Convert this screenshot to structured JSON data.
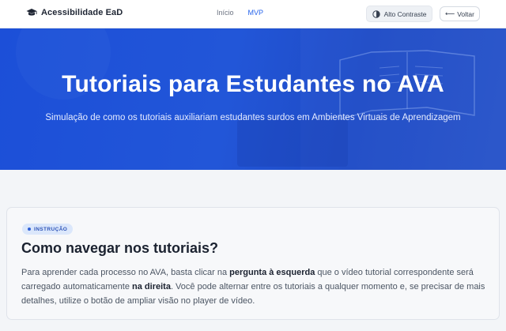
{
  "nav": {
    "brand": "Acessibilidade EaD",
    "links": [
      {
        "label": "Início",
        "active": false
      },
      {
        "label": "MVP",
        "active": true
      }
    ],
    "contrast_label": "Alto Contraste",
    "back_label": "Voltar"
  },
  "hero": {
    "title": "Tutoriais para Estudantes no AVA",
    "subtitle": "Simulação de como os tutoriais auxiliariam estudantes surdos em Ambientes Virtuais de Aprendizagem"
  },
  "card": {
    "badge": "INSTRUÇÃO",
    "title": "Como navegar nos tutoriais?",
    "body": {
      "p1": "Para aprender cada processo no AVA, basta clicar na ",
      "b1": "pergunta à esquerda",
      "p2": " que o vídeo tutorial correspondente será carregado automaticamente ",
      "b2": "na direita",
      "p3": ". Você pode alternar entre os tutoriais a qualquer momento e, se precisar de mais detalhes, utilize o botão de ampliar visão no player de vídeo."
    }
  },
  "colors": {
    "accent": "#2563eb",
    "hero_bg": "#1c4fd8",
    "badge_bg": "#dbe7fb",
    "badge_text": "#2f55b8"
  },
  "icons": {
    "brand": "graduation-cap-icon",
    "contrast": "half-circle-contrast-icon",
    "back": "arrow-left-icon"
  }
}
